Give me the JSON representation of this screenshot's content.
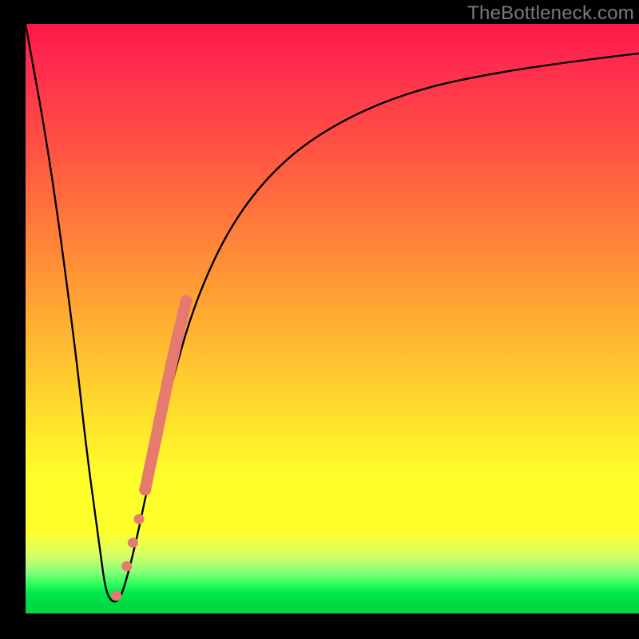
{
  "watermark": "TheBottleneck.com",
  "colors": {
    "marker": "#e77a6f",
    "curve": "#000000",
    "frame": "#000000"
  },
  "chart_data": {
    "type": "line",
    "title": "",
    "xlabel": "",
    "ylabel": "",
    "xlim": [
      0,
      100
    ],
    "ylim": [
      0,
      100
    ],
    "grid": false,
    "legend": false,
    "series": [
      {
        "name": "bottleneck-curve",
        "x": [
          0,
          4,
          8,
          10,
          12,
          13,
          14,
          15,
          16,
          18,
          20,
          24,
          28,
          34,
          42,
          52,
          64,
          78,
          92,
          100
        ],
        "y": [
          100,
          77,
          46,
          27,
          12,
          4,
          2,
          2,
          4,
          12,
          22,
          40,
          54,
          67,
          77,
          84,
          89,
          92,
          94,
          95
        ]
      }
    ],
    "markers": {
      "name": "highlight-points",
      "description": "salmon dots along rising branch near valley",
      "x": [
        14.8,
        16.5,
        17.5,
        18.5,
        19.5,
        20.5,
        21.5,
        22.5,
        23.5,
        24.8,
        26.2
      ],
      "y": [
        3,
        8,
        12,
        16,
        21,
        26,
        31,
        36,
        41,
        47,
        53
      ]
    }
  }
}
